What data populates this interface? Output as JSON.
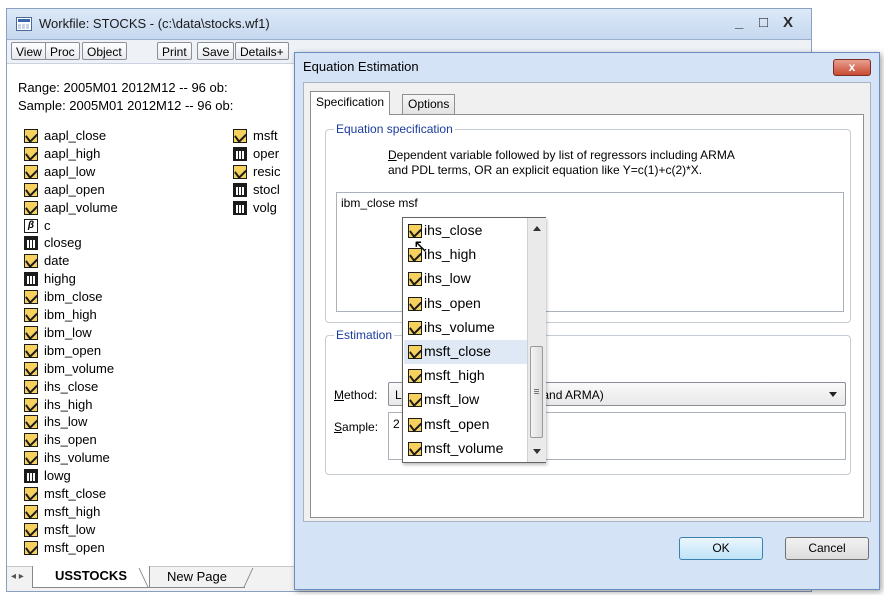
{
  "workfile": {
    "title": "Workfile: STOCKS - (c:\\data\\stocks.wf1)",
    "window_buttons": {
      "minimize": "_",
      "maximize": "□",
      "close": "X"
    },
    "toolbar": [
      "View",
      "Proc",
      "Object",
      "Print",
      "Save",
      "Details+"
    ],
    "range": "Range:  2005M01 2012M12  --  96 ob:",
    "sample": "Sample: 2005M01 2012M12  --  96 ob:",
    "objects_col1": [
      {
        "name": "aapl_close",
        "icon": "series-icon"
      },
      {
        "name": "aapl_high",
        "icon": "series-icon"
      },
      {
        "name": "aapl_low",
        "icon": "series-icon"
      },
      {
        "name": "aapl_open",
        "icon": "series-icon"
      },
      {
        "name": "aapl_volume",
        "icon": "series-icon"
      },
      {
        "name": "c",
        "icon": "coef-icon"
      },
      {
        "name": "closeg",
        "icon": "graph-icon"
      },
      {
        "name": "date",
        "icon": "series-icon"
      },
      {
        "name": "highg",
        "icon": "graph-icon"
      },
      {
        "name": "ibm_close",
        "icon": "series-icon"
      },
      {
        "name": "ibm_high",
        "icon": "series-icon"
      },
      {
        "name": "ibm_low",
        "icon": "series-icon"
      },
      {
        "name": "ibm_open",
        "icon": "series-icon"
      },
      {
        "name": "ibm_volume",
        "icon": "series-icon"
      },
      {
        "name": "ihs_close",
        "icon": "series-icon"
      },
      {
        "name": "ihs_high",
        "icon": "series-icon"
      },
      {
        "name": "ihs_low",
        "icon": "series-icon"
      },
      {
        "name": "ihs_open",
        "icon": "series-icon"
      },
      {
        "name": "ihs_volume",
        "icon": "series-icon"
      },
      {
        "name": "lowg",
        "icon": "graph-icon"
      },
      {
        "name": "msft_close",
        "icon": "series-icon"
      },
      {
        "name": "msft_high",
        "icon": "series-icon"
      },
      {
        "name": "msft_low",
        "icon": "series-icon"
      },
      {
        "name": "msft_open",
        "icon": "series-icon"
      }
    ],
    "objects_col2": [
      {
        "name": "msft",
        "icon": "series-icon"
      },
      {
        "name": "oper",
        "icon": "graph-icon"
      },
      {
        "name": "resic",
        "icon": "series-icon"
      },
      {
        "name": "stocl",
        "icon": "graph-icon"
      },
      {
        "name": "volg",
        "icon": "graph-icon"
      }
    ],
    "tabs": {
      "nav": "◂ ▸",
      "active": "USSTOCKS",
      "other": "New Page"
    }
  },
  "dialog": {
    "title": "Equation Estimation",
    "close": "x",
    "tabs": [
      "Specification",
      "Options"
    ],
    "spec_group_title": "Equation specification",
    "spec_help_line1": "Dependent variable followed by list of regressors including ARMA",
    "spec_help_line2": "and PDL terms, OR an explicit equation like Y=c(1)+c(2)*X.",
    "spec_text": "ibm_close msf",
    "est_group_title": "Estimation",
    "method_label": "Method:",
    "method_value": "LS - Least Squares (NLS and ARMA)",
    "method_visible_left": "L",
    "method_visible_right": "; and ARMA)",
    "sample_label": "Sample:",
    "sample_value": "2",
    "ok": "OK",
    "cancel": "Cancel"
  },
  "autocomplete": {
    "items": [
      "ihs_close",
      "ihs_high",
      "ihs_low",
      "ihs_open",
      "ihs_volume",
      "msft_close",
      "msft_high",
      "msft_low",
      "msft_open",
      "msft_volume"
    ],
    "selected": "msft_close"
  },
  "colors": {
    "series_icon_fill": "#f6d15e",
    "dialog_frame": "#d4e3f6",
    "group_title": "#1a3c9c",
    "close_button": "#c94a32"
  }
}
